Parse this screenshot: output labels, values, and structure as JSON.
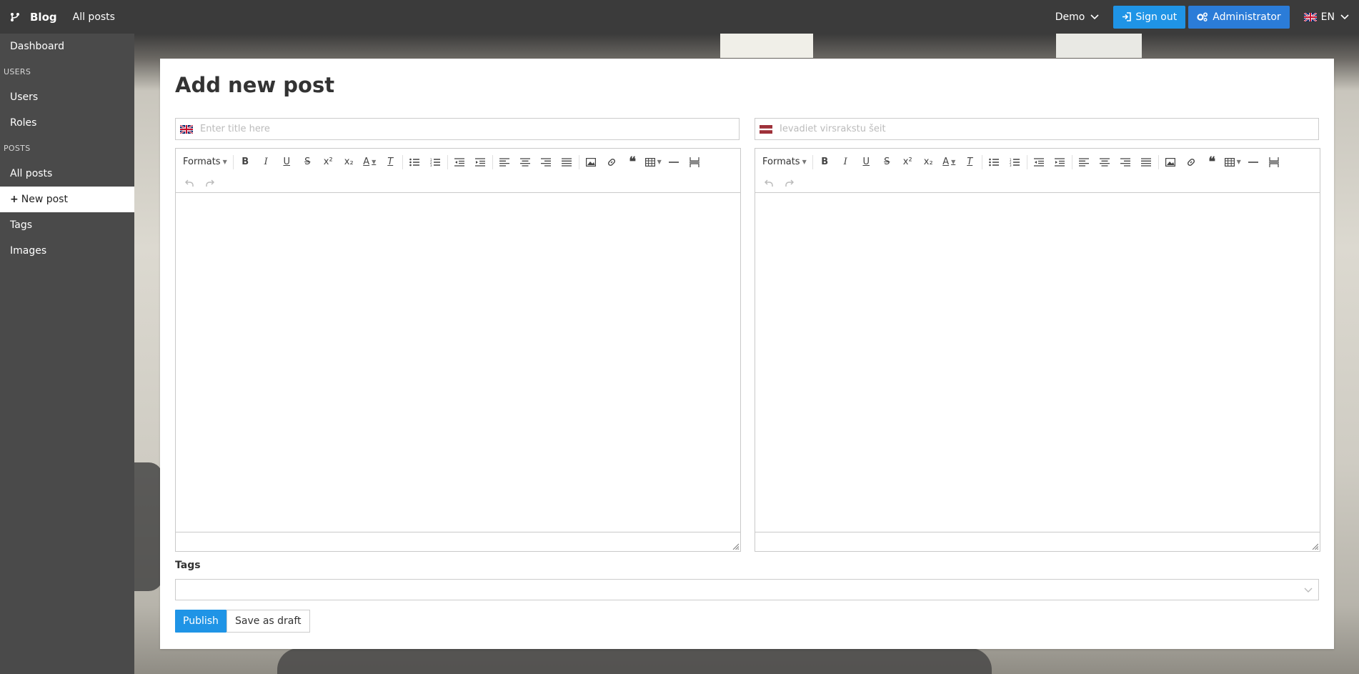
{
  "topbar": {
    "brand": "Blog",
    "nav_link": "All posts",
    "demo_label": "Demo",
    "signout_label": "Sign out",
    "admin_label": "Administrator",
    "lang_label": "EN"
  },
  "sidebar": {
    "dashboard": "Dashboard",
    "section_users": "USERS",
    "users": "Users",
    "roles": "Roles",
    "section_posts": "POSTS",
    "all_posts": "All posts",
    "new_post": "New post",
    "tags": "Tags",
    "images": "Images"
  },
  "main": {
    "title": "Add new post",
    "title_en_placeholder": "Enter title here",
    "title_lv_placeholder": "Ievadiet virsrakstu šeit",
    "toolbar_formats": "Formats",
    "tags_label": "Tags",
    "publish_label": "Publish",
    "draft_label": "Save as draft"
  },
  "colors": {
    "topbar": "#3b3b3b",
    "sidebar": "#4a4a4a",
    "primary": "#1f94e6",
    "admin": "#2b7cd8"
  }
}
